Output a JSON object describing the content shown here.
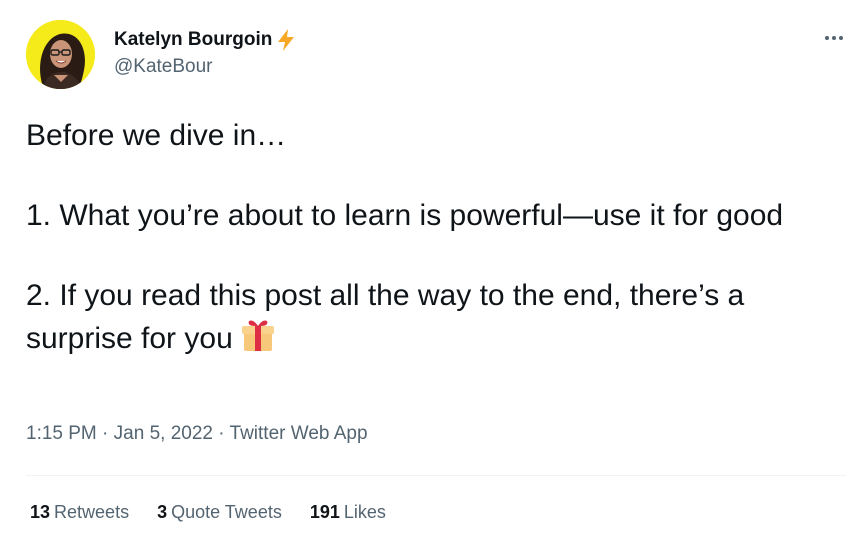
{
  "author": {
    "display_name": "Katelyn Bourgoin",
    "handle": "@KateBour",
    "badge_icon": "lightning-bolt-icon",
    "avatar_bg": "#f5ea1a"
  },
  "tweet": {
    "lines": [
      "Before we dive in…",
      "1. What you’re about to learn is powerful—use it for good",
      "2. If you read this post all the way to the end, there’s a surprise for you"
    ],
    "emoji_icon": "gift-icon"
  },
  "meta": {
    "time": "1:15 PM",
    "separator": " · ",
    "date": "Jan 5, 2022",
    "source": "Twitter Web App"
  },
  "stats": {
    "retweets_count": "13",
    "retweets_label": "Retweets",
    "quotes_count": "3",
    "quotes_label": "Quote Tweets",
    "likes_count": "191",
    "likes_label": "Likes"
  },
  "colors": {
    "text_primary": "#0f1419",
    "text_secondary": "#536471",
    "divider": "#eff3f4",
    "bolt": "#f9a825"
  }
}
